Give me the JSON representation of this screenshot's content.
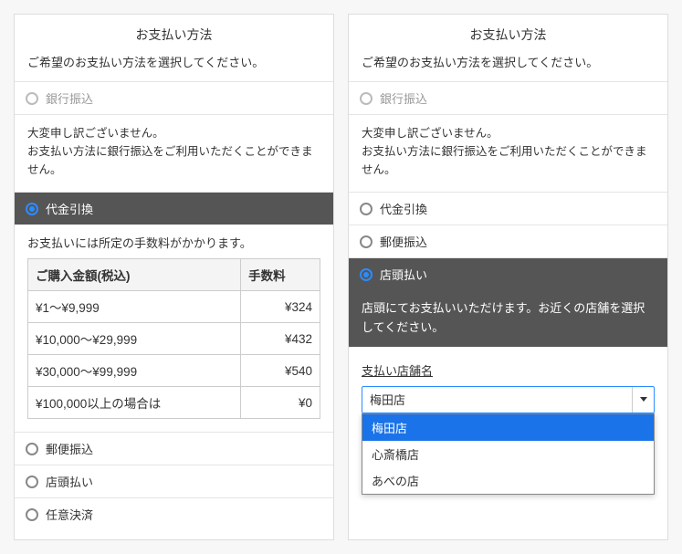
{
  "left": {
    "title": "お支払い方法",
    "desc": "ご希望のお支払い方法を選択してください。",
    "opt_bank": "銀行振込",
    "apology1": "大変申し訳ございません。",
    "apology2": "お支払い方法に銀行振込をご利用いただくことができません。",
    "opt_cod": "代金引換",
    "cod_note": "お支払いには所定の手数料がかかります。",
    "th_amount": "ご購入金額(税込)",
    "th_fee": "手数料",
    "rows": [
      {
        "range": "¥1～¥9,999",
        "fee": "¥324"
      },
      {
        "range": "¥10,000～¥29,999",
        "fee": "¥432"
      },
      {
        "range": "¥30,000～¥99,999",
        "fee": "¥540"
      },
      {
        "range": "¥100,000以上の場合は",
        "fee": "¥0"
      }
    ],
    "opt_postal": "郵便振込",
    "opt_store": "店頭払い",
    "opt_any": "任意決済"
  },
  "right": {
    "title": "お支払い方法",
    "desc": "ご希望のお支払い方法を選択してください。",
    "opt_bank": "銀行振込",
    "apology1": "大変申し訳ございません。",
    "apology2": "お支払い方法に銀行振込をご利用いただくことができません。",
    "opt_cod": "代金引換",
    "opt_postal": "郵便振込",
    "opt_store": "店頭払い",
    "store_note": "店頭にてお支払いいただけます。お近くの店舗を選択してください。",
    "field_label": "支払い店舗名",
    "selected_store": "梅田店",
    "dropdown": [
      "梅田店",
      "心斎橋店",
      "あべの店"
    ]
  }
}
